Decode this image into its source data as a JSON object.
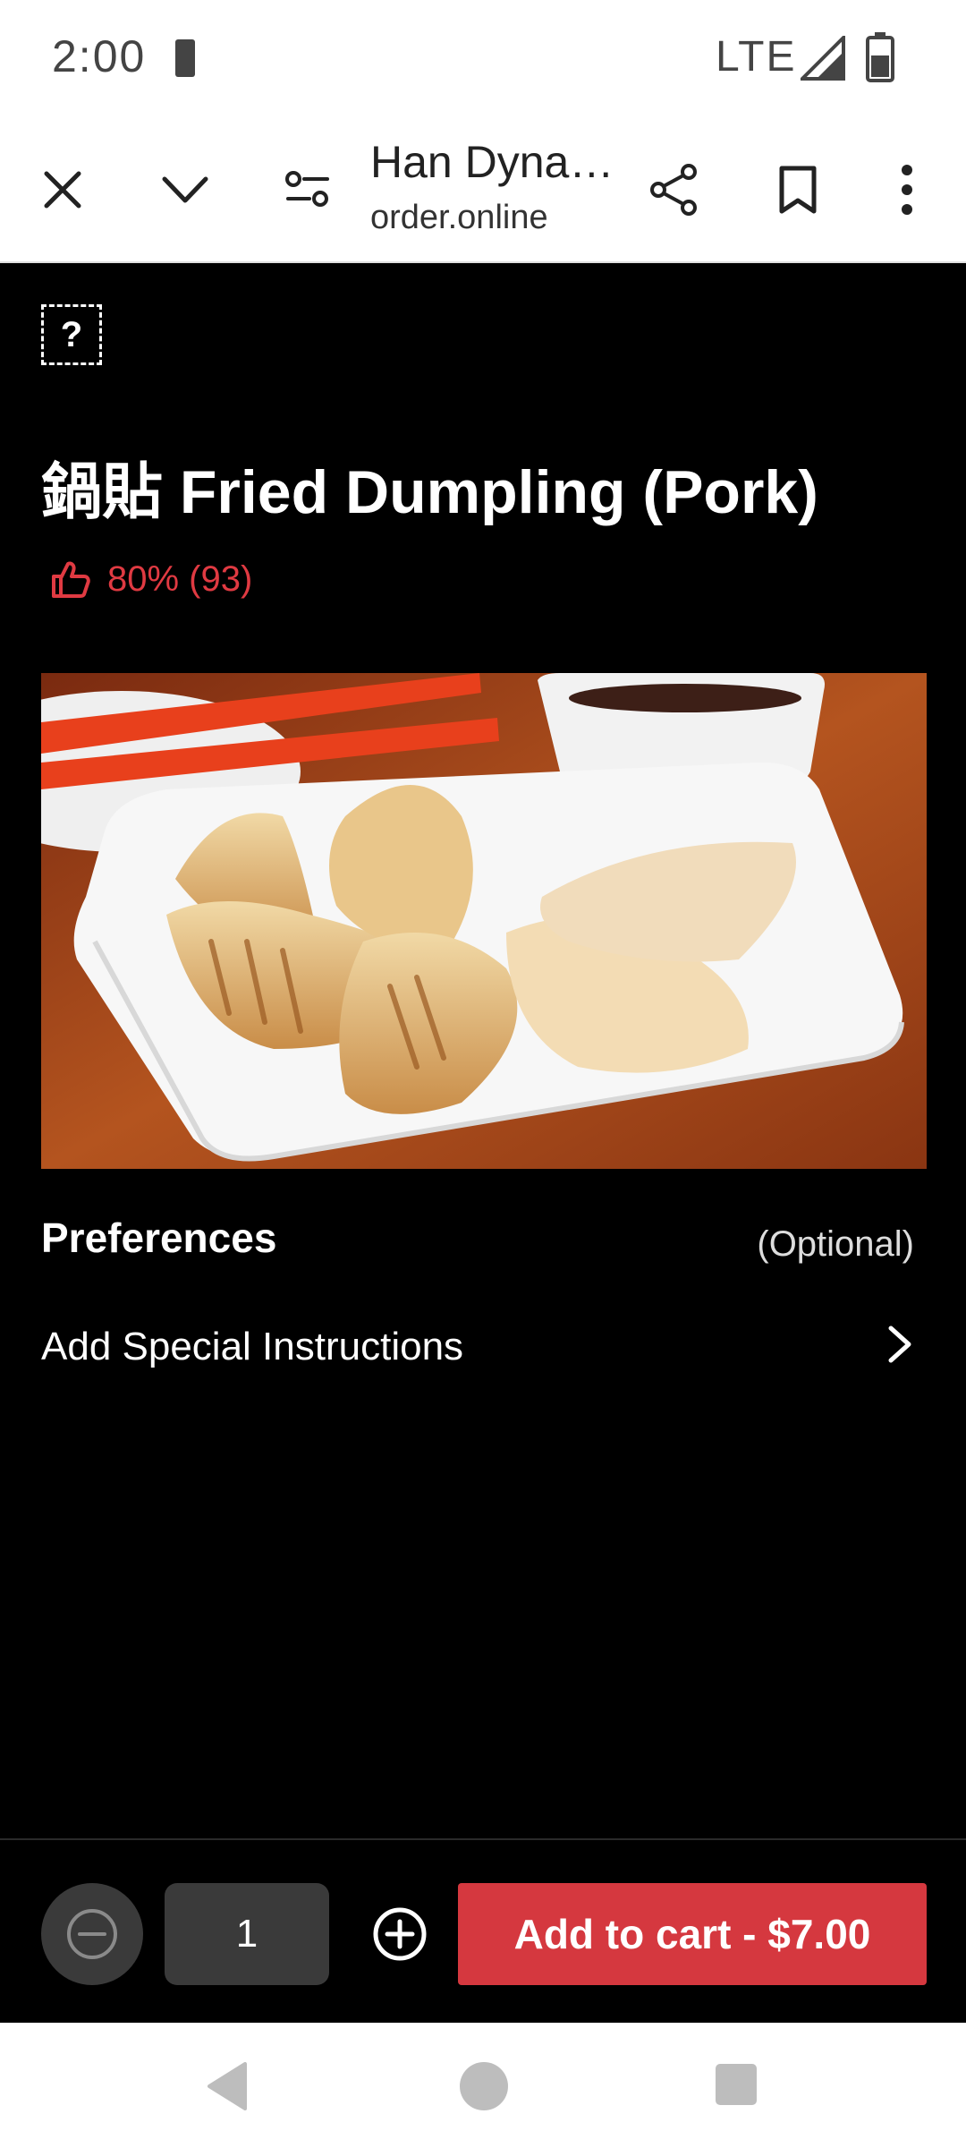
{
  "status": {
    "time": "2:00",
    "network": "LTE"
  },
  "browser": {
    "title": "Han Dyna…",
    "url": "order.online",
    "icons": [
      "close-icon",
      "chevron-down-icon",
      "site-settings-icon",
      "share-icon",
      "bookmark-icon",
      "more-icon"
    ]
  },
  "item": {
    "help_icon_glyph": "?",
    "title": "鍋貼 Fried Dumpling (Pork)",
    "rating": "80% (93)",
    "accent_color": "#e03a42"
  },
  "preferences": {
    "heading": "Preferences",
    "optional_label": "(Optional)",
    "special_instructions_label": "Add Special Instructions"
  },
  "cart": {
    "quantity": "1",
    "add_button_label": "Add to cart - $7.00",
    "button_color": "#d5383f"
  }
}
